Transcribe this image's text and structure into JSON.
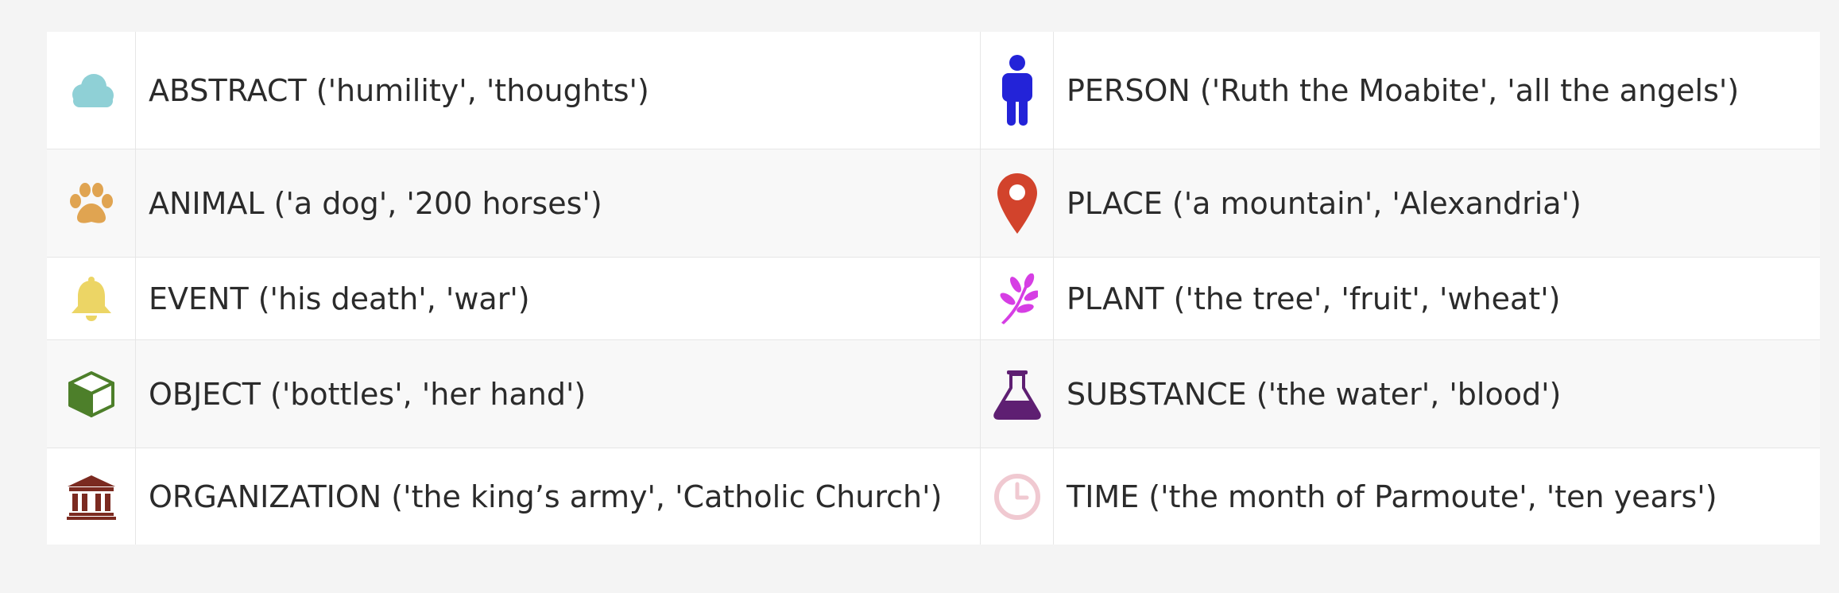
{
  "legend": {
    "items": [
      {
        "label": "ABSTRACT ('humility', 'thoughts')",
        "icon": "cloud-icon",
        "color": "#8fd0d6"
      },
      {
        "label": "PERSON ('Ruth the Moabite', 'all the angels')",
        "icon": "person-icon",
        "color": "#2323d8"
      },
      {
        "label": "ANIMAL ('a dog', '200 horses')",
        "icon": "paw-icon",
        "color": "#e0a451"
      },
      {
        "label": "PLACE ('a mountain', 'Alexandria')",
        "icon": "map-pin-icon",
        "color": "#d2432c"
      },
      {
        "label": "EVENT ('his death', 'war')",
        "icon": "bell-icon",
        "color": "#ecd565"
      },
      {
        "label": "PLANT ('the tree', 'fruit', 'wheat')",
        "icon": "leaf-sprig-icon",
        "color": "#d63ee4"
      },
      {
        "label": "OBJECT ('bottles', 'her hand')",
        "icon": "cube-icon",
        "color": "#4d7f2a"
      },
      {
        "label": "SUBSTANCE ('the water', 'blood')",
        "icon": "flask-icon",
        "color": "#5e1f72"
      },
      {
        "label": "ORGANIZATION ('the king’s army', 'Catholic Church')",
        "icon": "institution-icon",
        "color": "#7b2a20"
      },
      {
        "label": "TIME ('the month of Parmoute', 'ten years')",
        "icon": "clock-icon",
        "color": "#f0c9d1"
      }
    ]
  }
}
